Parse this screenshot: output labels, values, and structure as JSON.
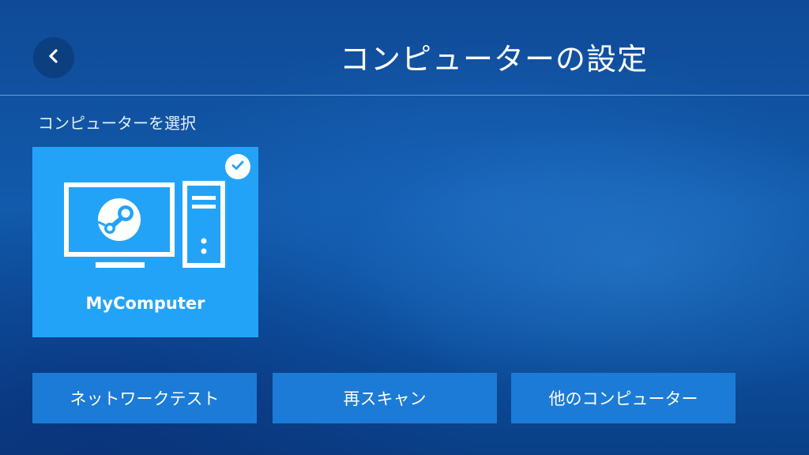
{
  "header": {
    "title": "コンピューターの設定",
    "back_icon": "chevron-left-icon"
  },
  "section": {
    "label": "コンピューターを選択"
  },
  "computers": [
    {
      "name": "MyComputer",
      "selected": true,
      "icon": "steam-computer-icon",
      "badge_icon": "checkmark-icon"
    }
  ],
  "actions": {
    "network_test": "ネットワークテスト",
    "rescan": "再スキャン",
    "other_computers": "他のコンピューター"
  },
  "colors": {
    "accent": "#23a3f8",
    "button": "#1c7bd6",
    "back_button": "#0c3f7f"
  }
}
